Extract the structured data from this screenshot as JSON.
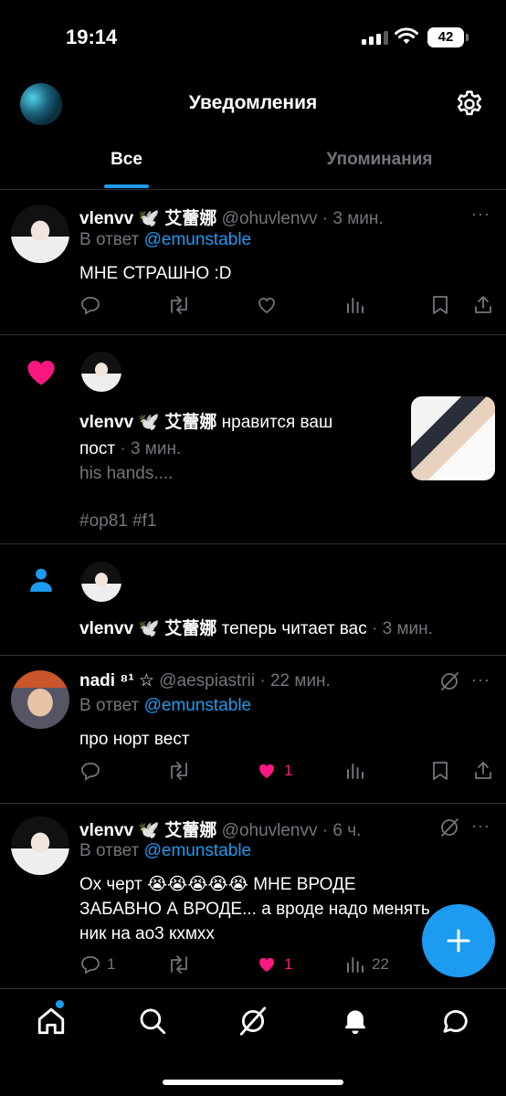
{
  "status_bar": {
    "time": "19:14",
    "battery": "42"
  },
  "header": {
    "title": "Уведомления"
  },
  "tabs": [
    {
      "label": "Все",
      "active": true
    },
    {
      "label": "Упоминания",
      "active": false
    }
  ],
  "notifications": [
    {
      "type": "reply",
      "name": "vlenvv 🕊️ 艾蕾娜",
      "handle": "@ohuvlenvv",
      "time": "· 3 мин.",
      "reply_prefix": "В ответ",
      "reply_to": "@emunstable",
      "text": "МНЕ СТРАШНО :D",
      "more": "···"
    },
    {
      "type": "like",
      "icon": "heart-icon",
      "actor": "vlenvv 🕊️ 艾蕾娜",
      "action": "нравится ваш",
      "action2": "пост",
      "time": "· 3 мин.",
      "post_text": "his hands....",
      "post_tags": "#op81 #f1"
    },
    {
      "type": "follow",
      "icon": "person-icon",
      "actor": "vlenvv 🕊️ 艾蕾娜",
      "action": "теперь читает вас",
      "time": "· 3 мин."
    },
    {
      "type": "reply",
      "name": "nadi ⁸¹ ☆",
      "handle": "@aespiastrii",
      "time": "· 22 мин.",
      "reply_prefix": "В ответ",
      "reply_to": "@emunstable",
      "text": "про норт вест",
      "like_count": "1",
      "more": "···"
    },
    {
      "type": "reply",
      "name": "vlenvv 🕊️ 艾蕾娜",
      "handle": "@ohuvlenvv",
      "time": "· 6 ч.",
      "reply_prefix": "В ответ",
      "reply_to": "@emunstable",
      "text_line1": "Ох черт 😭😭😭😭😭 МНЕ ВРОДЕ",
      "text_line2": "ЗАБАВНО А ВРОДЕ... а вроде надо менять",
      "text_line3": "ник на ао3 кхмхх",
      "reply_count": "1",
      "like_count": "1",
      "views_count": "22",
      "more": "···"
    }
  ],
  "colors": {
    "accent": "#1d9bf0",
    "like": "#f91880",
    "muted": "#71767b",
    "divider": "#2f3336"
  },
  "bottom_nav": [
    "home-icon",
    "search-icon",
    "grok-icon",
    "bell-icon",
    "messages-icon"
  ]
}
